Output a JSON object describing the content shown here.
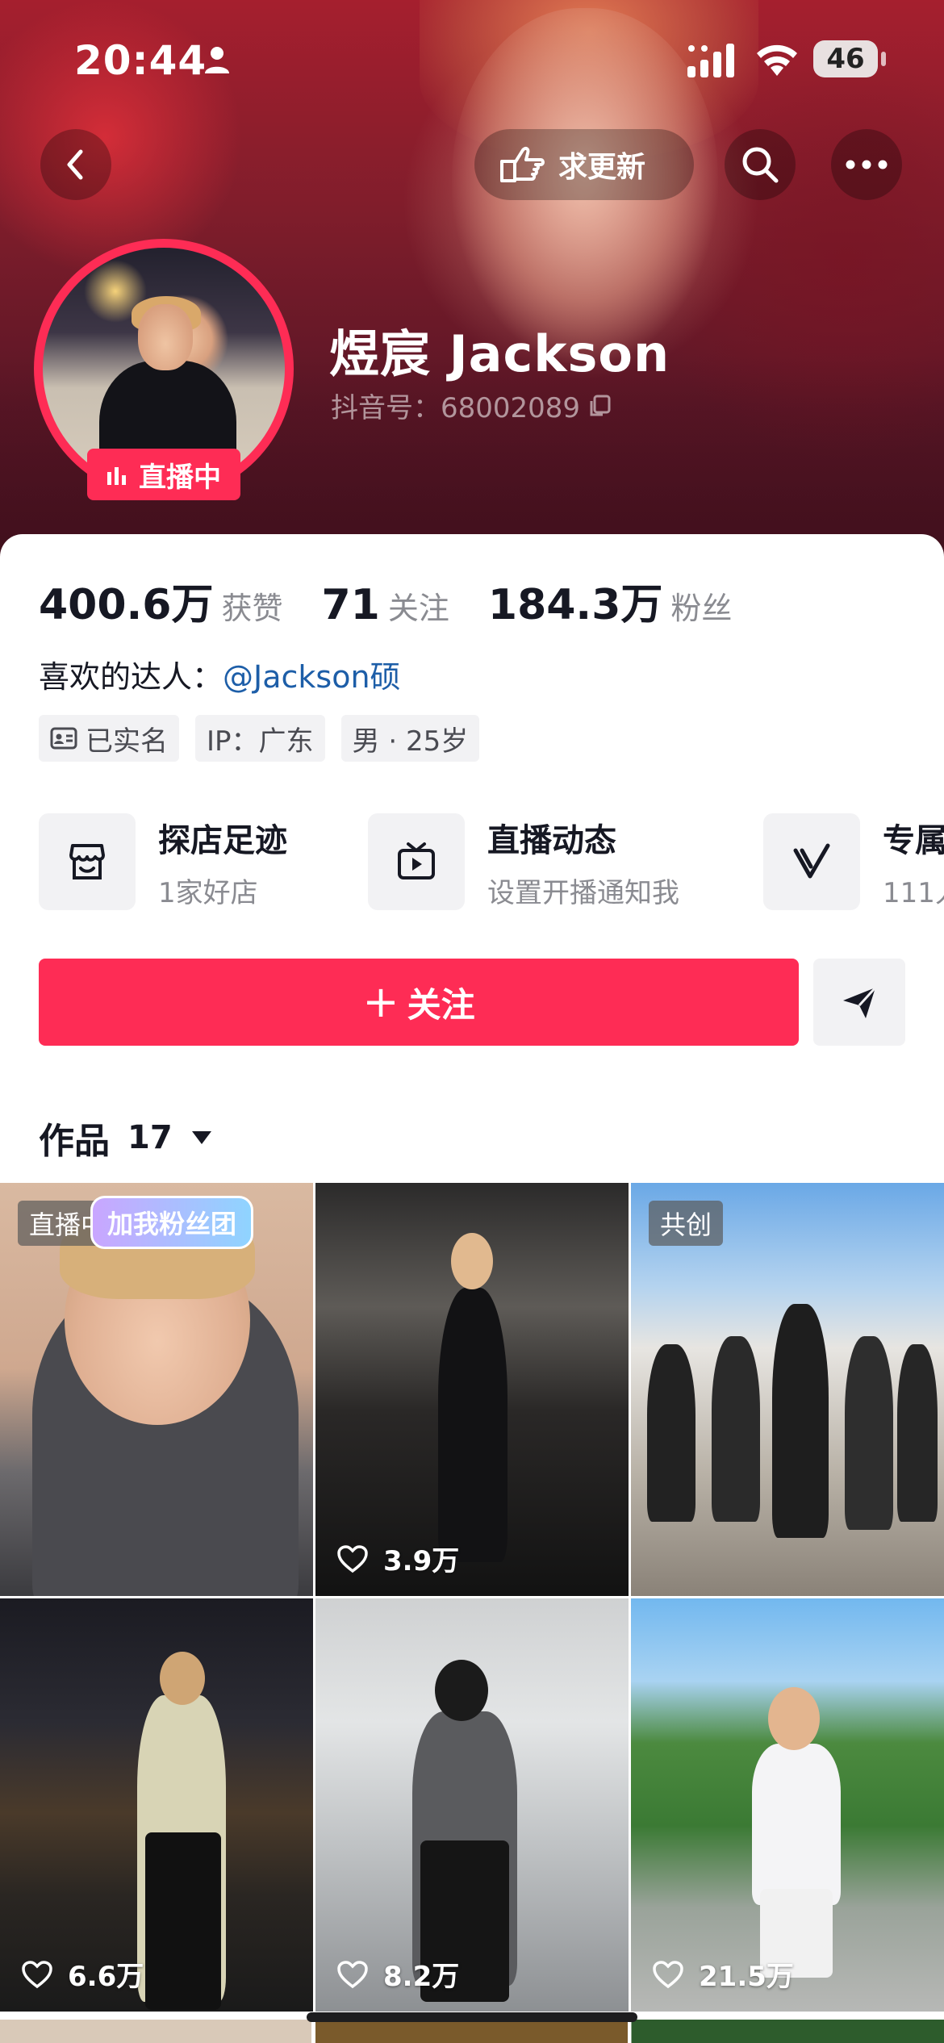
{
  "status_bar": {
    "time": "20:44",
    "battery": "46"
  },
  "nav": {
    "update_label": "求更新"
  },
  "profile": {
    "live_badge": "直播中",
    "nickname": "煜宸 Jackson",
    "douyin_id": "抖音号：68002089"
  },
  "stats": [
    {
      "value": "400.6万",
      "label": "获赞"
    },
    {
      "value": "71",
      "label": "关注"
    },
    {
      "value": "184.3万",
      "label": "粉丝"
    }
  ],
  "liked_creator": {
    "prefix": "喜欢的达人：",
    "name": "@Jackson硕"
  },
  "tags": [
    "已实名",
    "IP：广东",
    "男 · 25岁"
  ],
  "features": [
    {
      "title": "探店足迹",
      "subtitle": "1家好店",
      "icon": "shop-icon"
    },
    {
      "title": "直播动态",
      "subtitle": "设置开播通知我",
      "icon": "tv-icon"
    },
    {
      "title": "专属",
      "subtitle": "111人",
      "icon": "v-icon"
    }
  ],
  "actions": {
    "follow_label": "关注"
  },
  "works": {
    "label": "作品",
    "count": "17"
  },
  "videos": [
    {
      "badge": "直播中",
      "sticker": "加我粉丝团",
      "likes": ""
    },
    {
      "badge": "",
      "likes": "3.9万"
    },
    {
      "badge": "共创",
      "likes": ""
    },
    {
      "badge": "",
      "likes": "6.6万"
    },
    {
      "badge": "",
      "likes": "8.2万"
    },
    {
      "badge": "",
      "likes": "21.5万"
    }
  ],
  "colors": {
    "accent": "#fe2c55",
    "mention": "#1d5ea8"
  }
}
